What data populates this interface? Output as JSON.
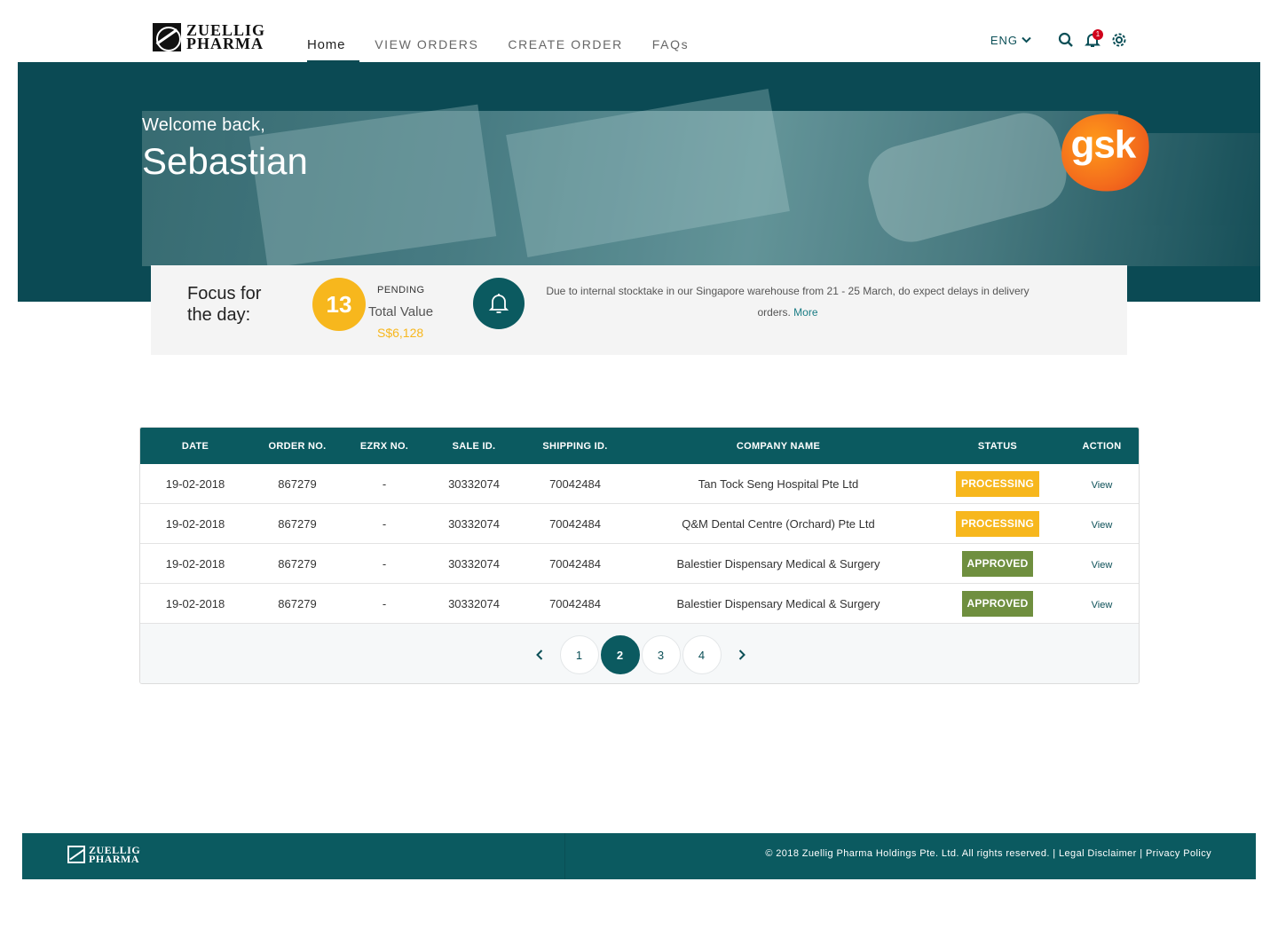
{
  "brand": {
    "line1": "ZUELLIG",
    "line2": "PHARMA"
  },
  "nav": {
    "home": "Home",
    "view_orders": "VIEW ORDERS",
    "create_order": "CREATE ORDER",
    "faqs": "FAQs"
  },
  "tools": {
    "language": "ENG",
    "notification_count": "1"
  },
  "hero": {
    "welcome": "Welcome back,",
    "user_name": "Sebastian",
    "partner_logo": "gsk"
  },
  "focus": {
    "title_line1": "Focus for",
    "title_line2": "the day:",
    "pending_count": "13",
    "pending_label": "PENDING",
    "total_label": "Total Value",
    "total_value": "S$6,128",
    "notice_text": "Due to internal stocktake in our Singapore warehouse from 21 - 25 March, do expect delays in delivery orders.",
    "notice_more": "More"
  },
  "table": {
    "headers": [
      "DATE",
      "ORDER NO.",
      "EZRX NO.",
      "SALE ID.",
      "SHIPPING ID.",
      "COMPANY NAME",
      "STATUS",
      "ACTION"
    ],
    "rows": [
      {
        "date": "19-02-2018",
        "order_no": "867279",
        "ezrx_no": "-",
        "sale_id": "30332074",
        "shipping_id": "70042484",
        "company": "Tan Tock Seng Hospital Pte Ltd",
        "status": "PROCESSING",
        "action": "View"
      },
      {
        "date": "19-02-2018",
        "order_no": "867279",
        "ezrx_no": "-",
        "sale_id": "30332074",
        "shipping_id": "70042484",
        "company": "Q&M Dental Centre (Orchard) Pte Ltd",
        "status": "PROCESSING",
        "action": "View"
      },
      {
        "date": "19-02-2018",
        "order_no": "867279",
        "ezrx_no": "-",
        "sale_id": "30332074",
        "shipping_id": "70042484",
        "company": "Balestier Dispensary Medical & Surgery",
        "status": "APPROVED",
        "action": "View"
      },
      {
        "date": "19-02-2018",
        "order_no": "867279",
        "ezrx_no": "-",
        "sale_id": "30332074",
        "shipping_id": "70042484",
        "company": "Balestier Dispensary Medical & Surgery",
        "status": "APPROVED",
        "action": "View"
      }
    ]
  },
  "pagination": {
    "pages": [
      "1",
      "2",
      "3",
      "4"
    ],
    "current": "2"
  },
  "footer": {
    "copyright": "© 2018 Zuellig Pharma Holdings Pte. Ltd. All rights reserved.",
    "separator": "|",
    "legal": "Legal Disclaimer",
    "privacy": "Privacy Policy"
  },
  "colors": {
    "primary": "#0b5a60",
    "accent": "#f7b71d",
    "approved": "#6f8f3f",
    "alert": "#d0021b"
  }
}
